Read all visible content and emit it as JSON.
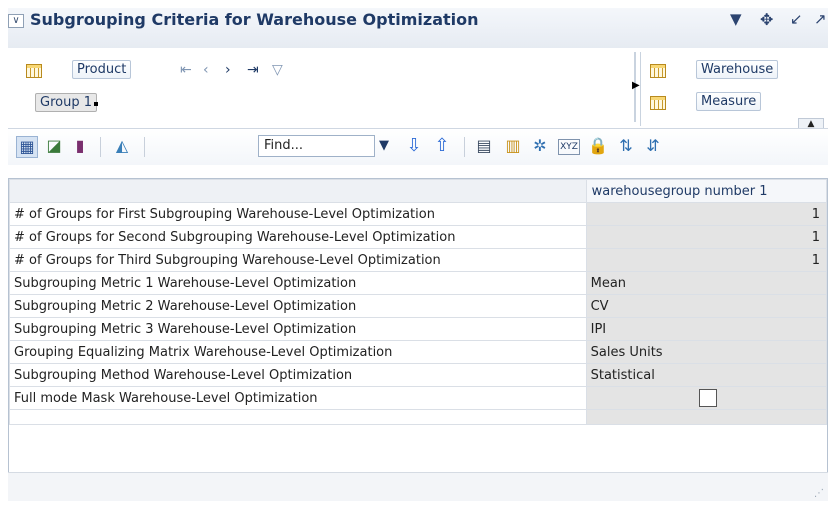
{
  "header": {
    "title": "Subgrouping Criteria for Warehouse Optimization"
  },
  "layout": {
    "product_label": "Product",
    "group_label": "Group 1",
    "warehouse_label": "Warehouse",
    "measure_label": "Measure"
  },
  "toolbar": {
    "find_placeholder": "Find..."
  },
  "grid": {
    "column_header": "warehousegroup number 1",
    "rows": [
      {
        "label": "# of Groups for First Subgrouping Warehouse-Level Optimization",
        "value": "1"
      },
      {
        "label": "# of Groups for Second Subgrouping Warehouse-Level Optimization",
        "value": "1"
      },
      {
        "label": "# of Groups for Third Subgrouping Warehouse-Level Optimization",
        "value": "1"
      },
      {
        "label": "Subgrouping Metric 1 Warehouse-Level Optimization",
        "value": "Mean"
      },
      {
        "label": "Subgrouping Metric 2 Warehouse-Level Optimization",
        "value": "CV"
      },
      {
        "label": "Subgrouping Metric 3 Warehouse-Level Optimization",
        "value": "IPI"
      },
      {
        "label": "Grouping Equalizing Matrix Warehouse-Level Optimization",
        "value": "Sales Units"
      },
      {
        "label": "Subgrouping Method Warehouse-Level Optimization",
        "value": "Statistical"
      },
      {
        "label": "Full mode Mask Warehouse-Level Optimization",
        "value": ""
      }
    ],
    "full_mode_checked": false
  },
  "colors": {
    "title_text": "#1f3a66",
    "value_cell_bg": "#e4e4e4",
    "toolbar_icon": "#2f5596"
  }
}
